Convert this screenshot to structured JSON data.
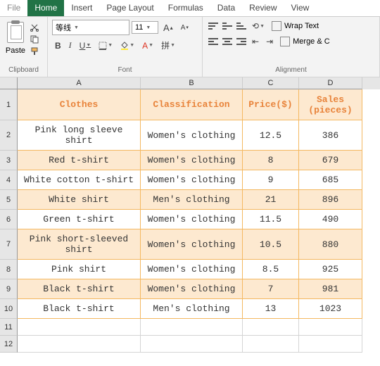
{
  "tabs": [
    "File",
    "Home",
    "Insert",
    "Page Layout",
    "Formulas",
    "Data",
    "Review",
    "View"
  ],
  "activeTab": 1,
  "ribbon": {
    "clipboard": {
      "label": "Clipboard",
      "paste": "Paste"
    },
    "font": {
      "label": "Font",
      "family": "等线",
      "size": "11",
      "aUp": "A",
      "aDn": "A",
      "b": "B",
      "i": "I",
      "u": "U",
      "pin": "拼"
    },
    "align": {
      "label": "Alignment",
      "wrap": "Wrap Text",
      "merge": "Merge & C"
    }
  },
  "cols": [
    "A",
    "B",
    "C",
    "D"
  ],
  "headers": {
    "a": "Clothes",
    "b": "Classification",
    "c": "Price($)",
    "d": "Sales (pieces)"
  },
  "rows": [
    {
      "n": "2",
      "a": "Pink long sleeve shirt",
      "b": "Women's clothing",
      "c": "12.5",
      "d": "386"
    },
    {
      "n": "3",
      "a": "Red t-shirt",
      "b": "Women's clothing",
      "c": "8",
      "d": "679"
    },
    {
      "n": "4",
      "a": "White cotton t-shirt",
      "b": "Women's clothing",
      "c": "9",
      "d": "685"
    },
    {
      "n": "5",
      "a": "White shirt",
      "b": "Men's clothing",
      "c": "21",
      "d": "896"
    },
    {
      "n": "6",
      "a": "Green t-shirt",
      "b": "Women's clothing",
      "c": "11.5",
      "d": "490"
    },
    {
      "n": "7",
      "a": "Pink short-sleeved shirt",
      "b": "Women's clothing",
      "c": "10.5",
      "d": "880"
    },
    {
      "n": "8",
      "a": "Pink shirt",
      "b": "Women's clothing",
      "c": "8.5",
      "d": "925"
    },
    {
      "n": "9",
      "a": "Black t-shirt",
      "b": "Women's clothing",
      "c": "7",
      "d": "981"
    },
    {
      "n": "10",
      "a": "Black t-shirt",
      "b": "Men's clothing",
      "c": "13",
      "d": "1023"
    }
  ],
  "empty": [
    "11",
    "12"
  ]
}
